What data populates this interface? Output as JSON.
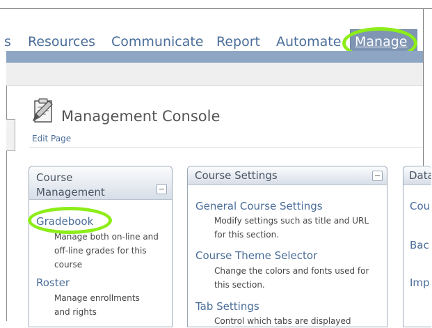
{
  "nav": {
    "items": [
      {
        "label": "s"
      },
      {
        "label": "Resources"
      },
      {
        "label": "Communicate"
      },
      {
        "label": "Report"
      },
      {
        "label": "Automate"
      }
    ],
    "active": "Manage"
  },
  "page": {
    "title": "Management Console",
    "edit_link": "Edit Page"
  },
  "modules": [
    {
      "title": "Course Management",
      "items": [
        {
          "link": "Gradebook",
          "desc": "Manage both on-line and off-line grades for this course"
        },
        {
          "link": "Roster",
          "desc": "Manage enrollments and rights"
        }
      ]
    },
    {
      "title": "Course Settings",
      "items": [
        {
          "link": "General Course Settings",
          "desc": "Modify settings such as title and URL for this section."
        },
        {
          "link": "Course Theme Selector",
          "desc": "Change the colors and fonts used for this section."
        },
        {
          "link": "Tab Settings",
          "desc": "Control which tabs are displayed"
        }
      ]
    },
    {
      "title": "Data",
      "items": [
        {
          "link": "Cou"
        },
        {
          "link": "Bac"
        },
        {
          "link": "Imp"
        }
      ]
    }
  ],
  "colors": {
    "link": "#4a6d99",
    "nav_bar": "#8fa5c4",
    "highlight": "#8ded18"
  }
}
